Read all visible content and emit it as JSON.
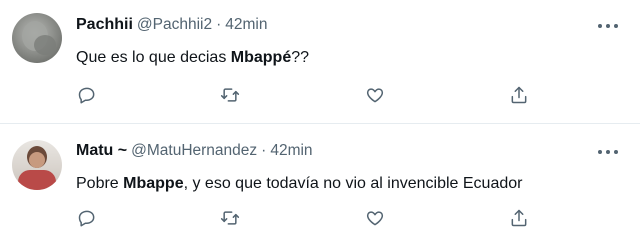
{
  "tweets": [
    {
      "display_name": "Pachhii",
      "handle": "@Pachhii2",
      "separator": "·",
      "time": "42min",
      "text_parts": {
        "before": "Que es lo que decias ",
        "bold": "Mbappé",
        "after": "??"
      }
    },
    {
      "display_name": "Matu ~",
      "handle": "@MatuHernandez",
      "separator": "·",
      "time": "42min",
      "text_parts": {
        "before": "Pobre ",
        "bold": "Mbappe",
        "after": ", y eso que todavía no vio al invencible Ecuador"
      }
    }
  ],
  "icons": {
    "reply": "reply-icon",
    "retweet": "retweet-icon",
    "like": "like-icon",
    "share": "share-icon",
    "more": "more-icon"
  },
  "colors": {
    "text": "#0f1419",
    "secondary": "#536471",
    "divider": "#e6ecf0"
  }
}
